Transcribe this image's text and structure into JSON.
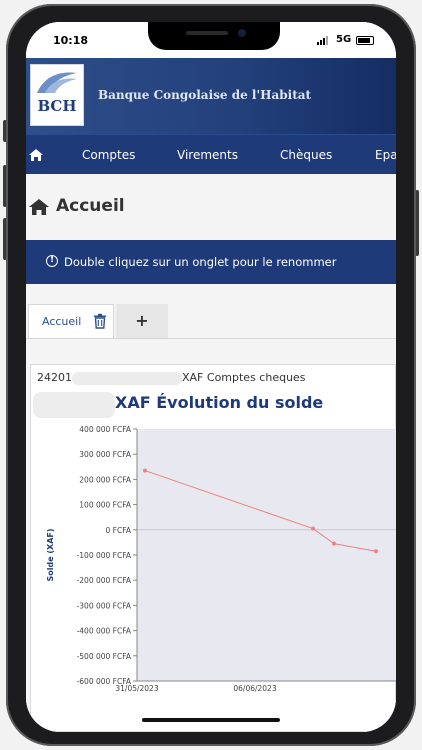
{
  "status_bar": {
    "time": "10:18",
    "network": "5G"
  },
  "bank": {
    "logo_text": "BCH",
    "name": "Banque Congolaise de l'Habitat"
  },
  "nav": {
    "items": [
      "Comptes",
      "Virements",
      "Chèques",
      "Epa"
    ]
  },
  "page": {
    "title": "Accueil"
  },
  "info": {
    "message": "Double cliquez sur un onglet pour le renommer"
  },
  "tabs": {
    "active_label": "Accueil",
    "add_label": "+"
  },
  "account": {
    "prefix": "24201",
    "suffix": "XAF Comptes cheques"
  },
  "chart_data": {
    "type": "line",
    "title": "XAF Évolution du solde",
    "ylabel": "Solde (XAF)",
    "ylim": [
      -600000,
      400000
    ],
    "y_ticks": [
      400000,
      300000,
      200000,
      100000,
      0,
      -100000,
      -200000,
      -300000,
      -400000,
      -500000,
      -600000
    ],
    "y_tick_labels": [
      "400 000 FCFA",
      "300 000 FCFA",
      "200 000 FCFA",
      "100 000 FCFA",
      "0 FCFA",
      "-100 000 FCFA",
      "-200 000 FCFA",
      "-300 000 FCFA",
      "-400 000 FCFA",
      "-500 000 FCFA",
      "-600 000 FCFA"
    ],
    "x_tick_labels": [
      "31/05/2023",
      "06/06/2023"
    ],
    "series": [
      {
        "color": "#f08080",
        "points": [
          {
            "x": "31/05/2023",
            "y": 235000
          },
          {
            "x": "08/06/2023",
            "y": 5000
          },
          {
            "x": "09/06/2023",
            "y": -55000
          },
          {
            "x": "11/06/2023",
            "y": -85000
          }
        ]
      }
    ]
  }
}
